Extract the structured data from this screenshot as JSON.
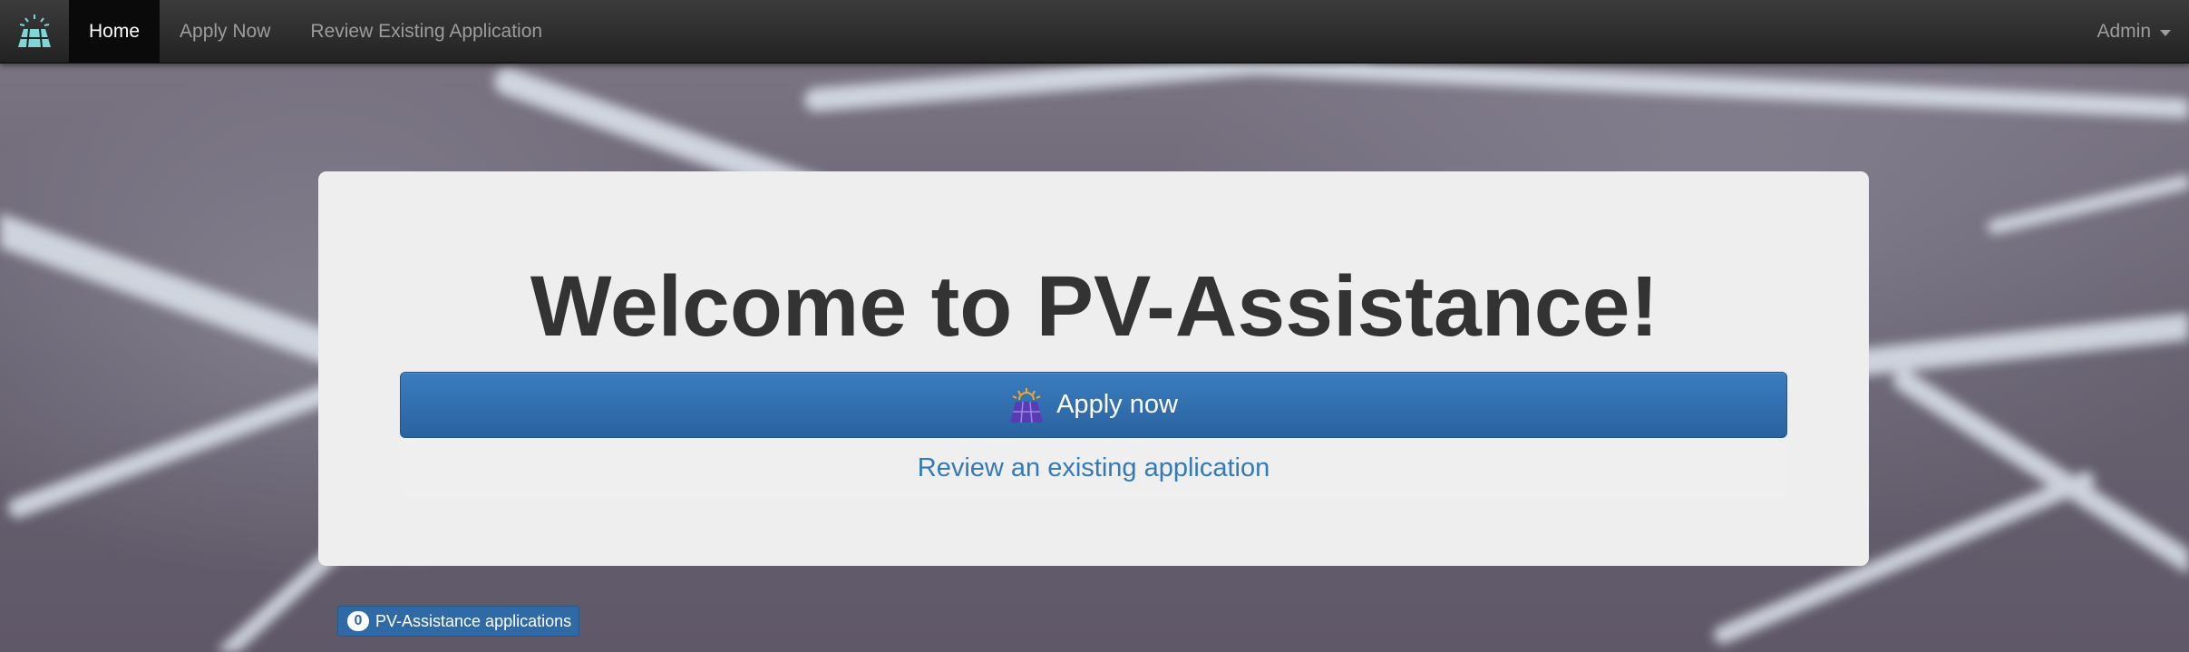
{
  "navbar": {
    "brand_icon": "solar-panel-icon",
    "links": [
      {
        "label": "Home",
        "active": true
      },
      {
        "label": "Apply Now",
        "active": false
      },
      {
        "label": "Review Existing Application",
        "active": false
      }
    ],
    "user_menu": {
      "label": "Admin",
      "icon": "caret-down-icon"
    }
  },
  "main": {
    "title": "Welcome to PV-Assistance!",
    "apply_button": {
      "label": "Apply now",
      "icon": "solar-panel-sun-icon"
    },
    "review_link": "Review an existing application"
  },
  "footer": {
    "application_count": "0",
    "application_label": "PV-Assistance applications"
  },
  "colors": {
    "navbar_bg": "#222222",
    "primary": "#337ab7",
    "jumbotron_bg": "#eeeeee",
    "text_dark": "#333333"
  }
}
